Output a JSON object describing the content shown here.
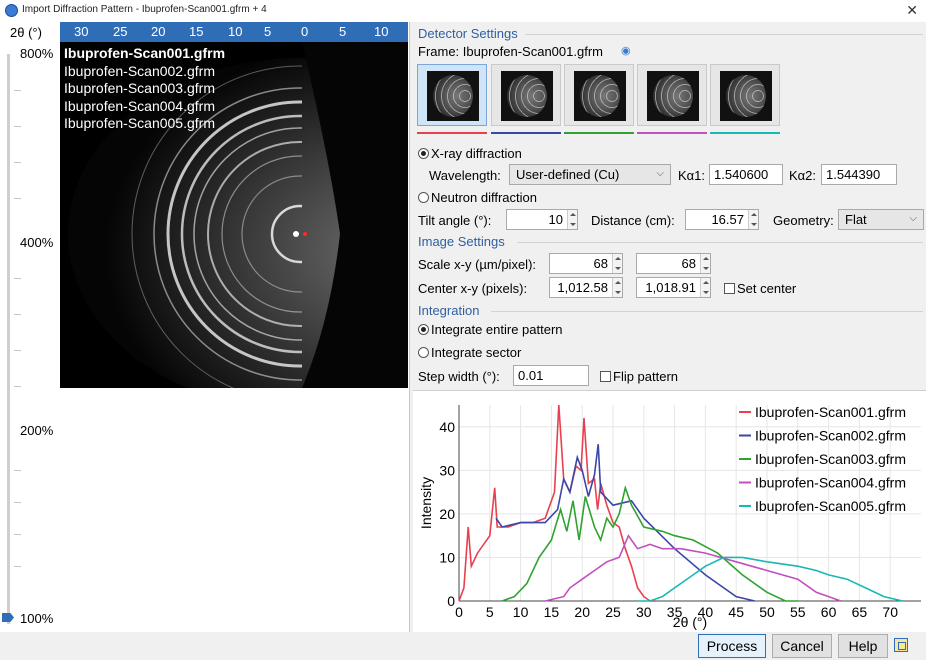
{
  "window": {
    "title": "Import Diffraction Pattern - Ibuprofen-Scan001.gfrm + 4",
    "close_glyph": "✕"
  },
  "left": {
    "axis_label": "2θ (°)",
    "axis_ticks": [
      "30",
      "25",
      "20",
      "15",
      "10",
      "5",
      "0",
      "5",
      "10"
    ],
    "zoom_levels": [
      "800%",
      "400%",
      "200%",
      "100%"
    ],
    "files": [
      "Ibuprofen-Scan001.gfrm",
      "Ibuprofen-Scan002.gfrm",
      "Ibuprofen-Scan003.gfrm",
      "Ibuprofen-Scan004.gfrm",
      "Ibuprofen-Scan005.gfrm"
    ]
  },
  "detector": {
    "title": "Detector Settings",
    "frame_label": "Frame: Ibuprofen-Scan001.gfrm",
    "xray_label": "X-ray diffraction",
    "wavelength_label": "Wavelength:",
    "wavelength_value": "User-defined (Cu)",
    "ka1_label": "Kα1:",
    "ka1_value": "1.540600",
    "ka2_label": "Kα2:",
    "ka2_value": "1.544390",
    "neutron_label": "Neutron diffraction",
    "tilt_label": "Tilt angle (°):",
    "tilt_value": "10",
    "distance_label": "Distance (cm):",
    "distance_value": "16.57",
    "geometry_label": "Geometry:",
    "geometry_value": "Flat"
  },
  "image_settings": {
    "title": "Image Settings",
    "scale_label": "Scale x-y (µm/pixel):",
    "scale_x": "68",
    "scale_y": "68",
    "center_label": "Center x-y (pixels):",
    "center_x": "1,012.58",
    "center_y": "1,018.91",
    "set_center_label": "Set center"
  },
  "integration": {
    "title": "Integration",
    "entire_label": "Integrate entire pattern",
    "sector_label": "Integrate sector",
    "step_label": "Step width (°):",
    "step_value": "0.01",
    "flip_label": "Flip pattern"
  },
  "buttons": {
    "process": "Process",
    "cancel": "Cancel",
    "help": "Help"
  },
  "colors": {
    "accent": "#2f6db6",
    "s1": "#e8404f",
    "s2": "#3a47a8",
    "s3": "#2fa32f",
    "s4": "#c24fc0",
    "s5": "#16b9b4"
  },
  "chart_data": {
    "type": "line",
    "xlabel": "2θ (°)",
    "ylabel": "Intensity",
    "xlim": [
      0,
      75
    ],
    "ylim": [
      0,
      45
    ],
    "xticks": [
      0,
      5,
      10,
      15,
      20,
      25,
      30,
      35,
      40,
      45,
      50,
      55,
      60,
      65,
      70
    ],
    "yticks": [
      0,
      10,
      20,
      30,
      40
    ],
    "grid": true,
    "legend_position": "top-right",
    "series": [
      {
        "name": "Ibuprofen-Scan001.gfrm",
        "color": "#e8404f",
        "x": [
          0,
          0.8,
          1.5,
          2,
          3,
          4,
          5,
          5.8,
          6.2,
          7,
          8,
          10,
          12,
          14,
          15.5,
          16.2,
          17,
          18,
          19,
          19.8,
          20.3,
          21,
          22,
          22.5,
          23,
          24,
          25,
          26,
          27,
          28,
          29,
          30,
          31,
          32
        ],
        "y": [
          0,
          3,
          17,
          8,
          11,
          13,
          15,
          26,
          17,
          17,
          17,
          18,
          18,
          19,
          25,
          45,
          28,
          25,
          31,
          30,
          42,
          27,
          28,
          21,
          27,
          22,
          18,
          17,
          12,
          8,
          3,
          1,
          0,
          0
        ]
      },
      {
        "name": "Ibuprofen-Scan002.gfrm",
        "color": "#3a47a8",
        "x": [
          6,
          7,
          10,
          14,
          16,
          17,
          18,
          19.2,
          20,
          21,
          22,
          22.6,
          23,
          25,
          28,
          30,
          35,
          40,
          45,
          48
        ],
        "y": [
          19,
          17,
          18,
          18,
          21,
          28,
          25,
          33,
          30,
          24,
          29,
          36,
          25,
          22,
          23,
          19,
          12,
          6,
          1,
          0
        ]
      },
      {
        "name": "Ibuprofen-Scan003.gfrm",
        "color": "#2fa32f",
        "x": [
          7,
          9,
          11,
          13,
          15,
          16.5,
          17.5,
          18.5,
          19.5,
          20.5,
          22,
          23,
          24,
          25,
          26,
          27,
          28,
          30,
          33,
          35,
          38,
          42,
          46,
          50,
          53,
          55
        ],
        "y": [
          0,
          1,
          4,
          10,
          14,
          21,
          16,
          23,
          14,
          24,
          17,
          14,
          19,
          17,
          20,
          26,
          22,
          17,
          16,
          15,
          14,
          11,
          6,
          2,
          0,
          0
        ]
      },
      {
        "name": "Ibuprofen-Scan004.gfrm",
        "color": "#c24fc0",
        "x": [
          14,
          17,
          18,
          20,
          22,
          24,
          26,
          27.5,
          29,
          31,
          33,
          36,
          40,
          45,
          50,
          55,
          58,
          60,
          62
        ],
        "y": [
          0,
          1,
          3,
          5,
          7,
          9,
          10,
          15,
          12,
          13,
          12,
          12,
          11,
          9,
          7,
          5,
          2,
          1,
          0
        ]
      },
      {
        "name": "Ibuprofen-Scan005.gfrm",
        "color": "#16b9b4",
        "x": [
          29,
          31,
          33,
          35,
          38,
          40,
          43,
          46,
          50,
          55,
          58,
          60,
          63,
          66,
          69,
          72
        ],
        "y": [
          0,
          0,
          1,
          3,
          6,
          8,
          10,
          10,
          9,
          8,
          7,
          6,
          5,
          3,
          1,
          0
        ]
      }
    ]
  }
}
